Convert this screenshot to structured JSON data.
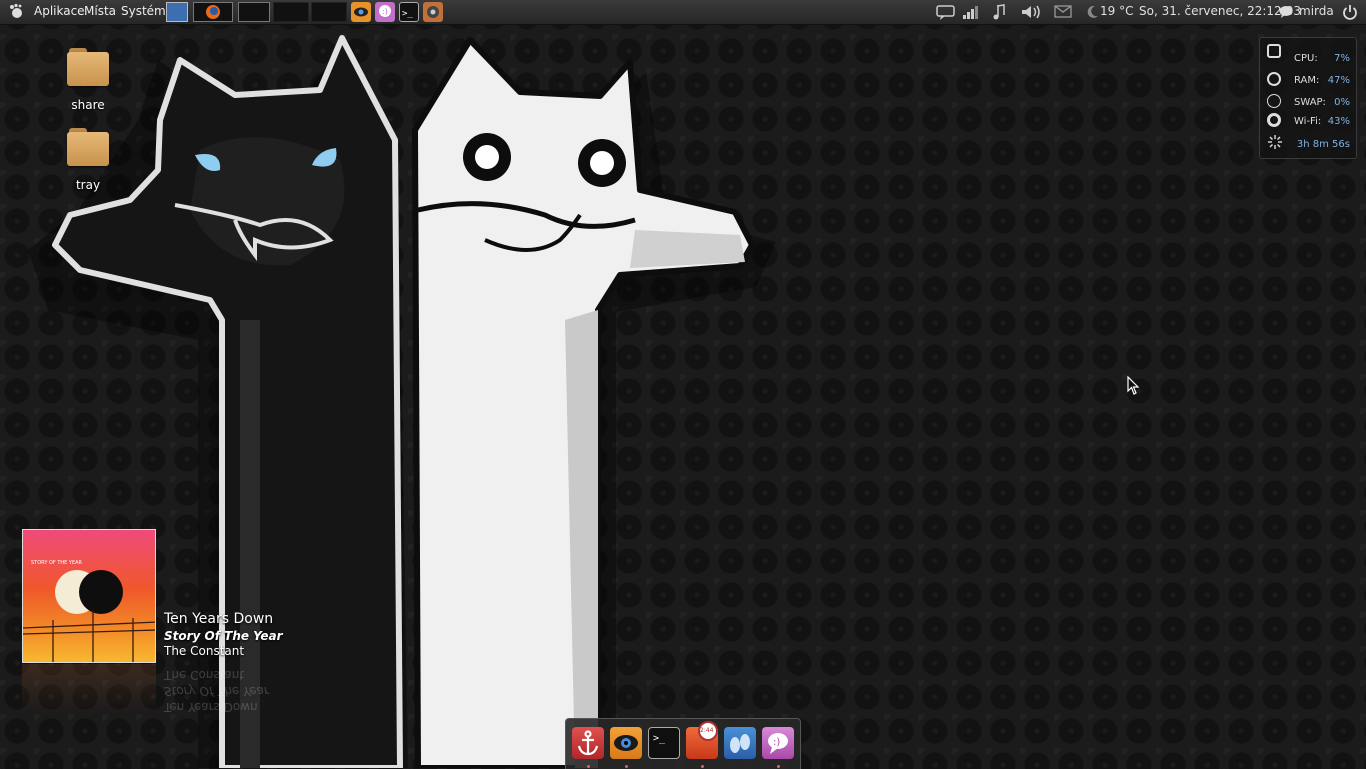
{
  "top_panel": {
    "menu": [
      "Aplikace",
      "Místa",
      "Systém"
    ],
    "weather": "19 °C",
    "datetime": "So, 31. červenec, 22:12:03",
    "user": "mirda",
    "icons": {
      "gnome_foot": "gnome-foot-icon",
      "firefox": "firefox-icon",
      "mail": "mail-icon",
      "volume": "volume-icon",
      "music": "music-note-icon",
      "network": "signal-icon",
      "chat": "chat-icon",
      "power": "power-icon"
    }
  },
  "desktop_icons": [
    {
      "label": "share",
      "icon": "folder-icon"
    },
    {
      "label": "tray",
      "icon": "folder-icon"
    }
  ],
  "system_monitor": {
    "rows": [
      {
        "label": "CPU:",
        "value": "7%"
      },
      {
        "label": "RAM:",
        "value": "47%"
      },
      {
        "label": "SWAP:",
        "value": "0%"
      },
      {
        "label": "Wi-Fi:",
        "value": "43%"
      }
    ],
    "uptime": "3h 8m 56s"
  },
  "now_playing": {
    "title": "Ten Years Down",
    "album": "Story Of The Year",
    "artist": "The Constant",
    "cover_text": "STORY OF THE YEAR"
  },
  "dock": {
    "items": [
      "anchor-icon",
      "eye-icon",
      "terminal-icon",
      "clock-icon",
      "footprints-icon",
      "chat-bubble-icon"
    ],
    "clock_badge": "2:44",
    "terminal_prompt": ">_"
  },
  "colors": {
    "panel_bg": "#2e2e2e",
    "accent_blue": "#7fb2e5",
    "album_pink": "#f04a7a",
    "album_orange": "#f28a28"
  }
}
